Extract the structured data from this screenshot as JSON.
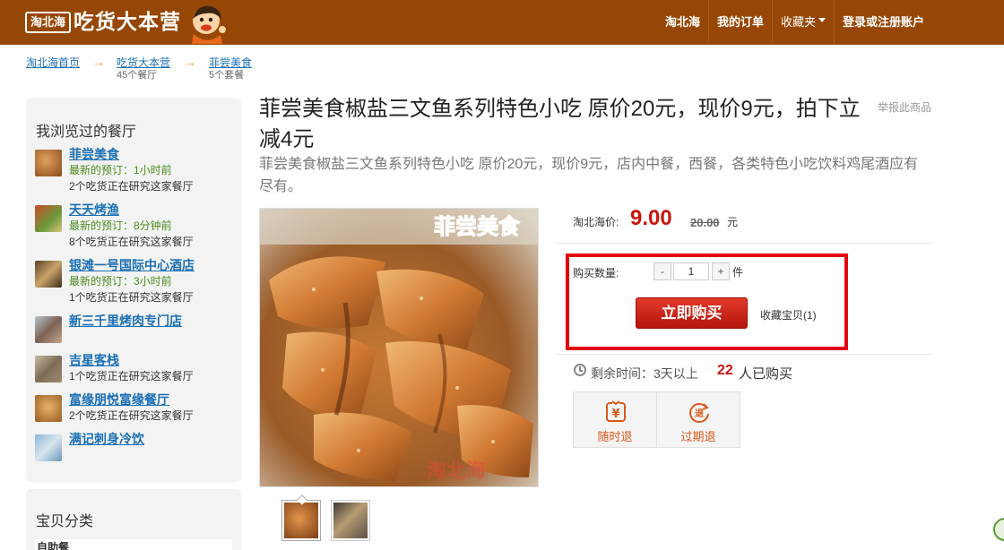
{
  "header": {
    "logo_box": "淘北海",
    "logo_text": "吃货大本营",
    "nav": [
      "淘北海",
      "我的订单",
      "收藏夹",
      "登录或注册账户"
    ]
  },
  "breadcrumb": [
    {
      "label": "淘北海首页",
      "sub": ""
    },
    {
      "label": "吃货大本营",
      "sub": "45个餐厅"
    },
    {
      "label": "菲尝美食",
      "sub": "5个套餐"
    }
  ],
  "sidebar": {
    "title": "我浏览过的餐厅",
    "items": [
      {
        "name": "菲尝美食",
        "line1": "最新的预订：1小时前",
        "line2": "2个吃货正在研究这家餐厅"
      },
      {
        "name": "天天烤渔",
        "line1": "最新的预订：8分钟前",
        "line2": "8个吃货正在研究这家餐厅"
      },
      {
        "name": "银滩一号国际中心酒店",
        "line1": "最新的预订：3小时前",
        "line2": "1个吃货正在研究这家餐厅"
      },
      {
        "name": "新三千里烤肉专门店",
        "line1": "",
        "line2": ""
      },
      {
        "name": "吉星客栈",
        "line1": "1个吃货正在研究这家餐厅",
        "line2": ""
      },
      {
        "name": "富缘朋悦富缘餐厅",
        "line1": "2个吃货正在研究这家餐厅",
        "line2": ""
      },
      {
        "name": "满记刺身冷饮",
        "line1": "",
        "line2": ""
      }
    ]
  },
  "sidebar2": {
    "title": "宝贝分类",
    "row": "自助餐"
  },
  "product": {
    "title": "菲尝美食椒盐三文鱼系列特色小吃 原价20元，现价9元，拍下立减4元",
    "report": "举报此商品",
    "desc": "菲尝美食椒盐三文鱼系列特色小吃 原价20元，现价9元，店内中餐，西餐，各类特色小吃饮料鸡尾酒应有尽有。",
    "img_caption": "菲尝美食",
    "img_watermark": "淘北海"
  },
  "price": {
    "label": "淘北海价:",
    "now": "9.00",
    "old": "20.00",
    "unit": "元"
  },
  "purchase": {
    "qty_label": "购买数量:",
    "minus": "-",
    "qty": "1",
    "plus": "+",
    "qty_unit": "件",
    "buy": "立即购买",
    "collect": "收藏宝贝(1)"
  },
  "status": {
    "remain": "剩余时间：3天以上",
    "bought_num": "22",
    "bought_txt": "人已购买"
  },
  "guarantees": [
    {
      "label": "随时退",
      "icon": "yen-return-icon"
    },
    {
      "label": "过期退",
      "icon": "refund-icon"
    }
  ],
  "colors": {
    "header_bg": "#974705",
    "link": "#1a6fb5",
    "price_red": "#c8160e",
    "highlight_box": "#e3000f",
    "guarantee_orange": "#d9581b"
  }
}
